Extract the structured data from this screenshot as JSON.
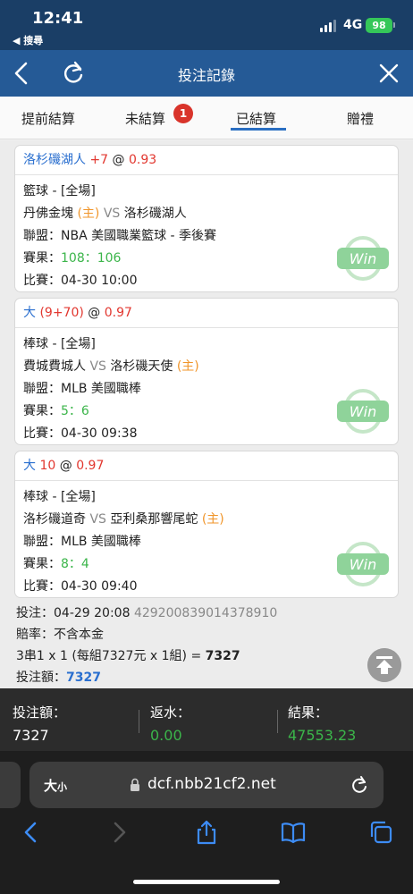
{
  "status_bar": {
    "time": "12:41",
    "back_app": "◀ 搜尋",
    "network": "4G",
    "battery": "98"
  },
  "nav": {
    "title": "投注記錄"
  },
  "tabs": [
    {
      "label": "提前結算"
    },
    {
      "label": "未結算",
      "badge": "1"
    },
    {
      "label": "已結算"
    },
    {
      "label": "贈禮"
    }
  ],
  "bets": [
    {
      "head_team": "洛杉磯湖人",
      "head_handicap": "+7",
      "head_at": "@",
      "head_odds": "0.93",
      "sport": "籃球 - [全場]",
      "team1": "丹佛金塊",
      "team1_tag": "(主)",
      "vs": "VS",
      "team2": "洛杉磯湖人",
      "team2_tag": "",
      "league": "聯盟：NBA 美國職業籃球 - 季後賽",
      "result_label": "賽果：",
      "result": "108：106",
      "time": "比賽：04-30 10:00",
      "badge": "Win"
    },
    {
      "head_team": "大",
      "head_handicap": "(9+70)",
      "head_at": "@",
      "head_odds": "0.97",
      "sport": "棒球 - [全場]",
      "team1": "費城費城人",
      "team1_tag": "",
      "vs": "VS",
      "team2": "洛杉磯天使",
      "team2_tag": "(主)",
      "league": "聯盟：MLB 美國職棒",
      "result_label": "賽果：",
      "result": "5：6",
      "time": "比賽：04-30 09:38",
      "badge": "Win"
    },
    {
      "head_team": "大",
      "head_handicap": "10",
      "head_at": "@",
      "head_odds": "0.97",
      "sport": "棒球 - [全場]",
      "team1": "洛杉磯道奇",
      "team1_tag": "",
      "vs": "VS",
      "team2": "亞利桑那響尾蛇",
      "team2_tag": "(主)",
      "league": "聯盟：MLB 美國職棒",
      "result_label": "賽果：",
      "result": "8：4",
      "time": "比賽：04-30 09:40",
      "badge": "Win"
    }
  ],
  "summary": {
    "bet_time": "投注：04-29 20:08",
    "bet_id": "429200839014378910",
    "odds_note": "賠率：不含本金",
    "parlay": "3串1 x 1 (每組7327元 x 1組) = ",
    "parlay_total": "7327",
    "amount_label": "投注額：",
    "amount": "7327"
  },
  "footer": {
    "stake_label": "投注額：",
    "stake": "7327",
    "rebate_label": "返水：",
    "rebate": "0.00",
    "result_label": "結果：",
    "result": "47553.23"
  },
  "browser": {
    "text_size_big": "大",
    "text_size_small": "小",
    "url": "dcf.nbb21cf2.net"
  },
  "colors": {
    "nav_blue": "#255a96",
    "status_blue": "#1a3e66",
    "win_green": "#3bb54a",
    "odds_red": "#e2372f",
    "home_orange": "#f0952a",
    "link_blue": "#2a6fcf"
  }
}
